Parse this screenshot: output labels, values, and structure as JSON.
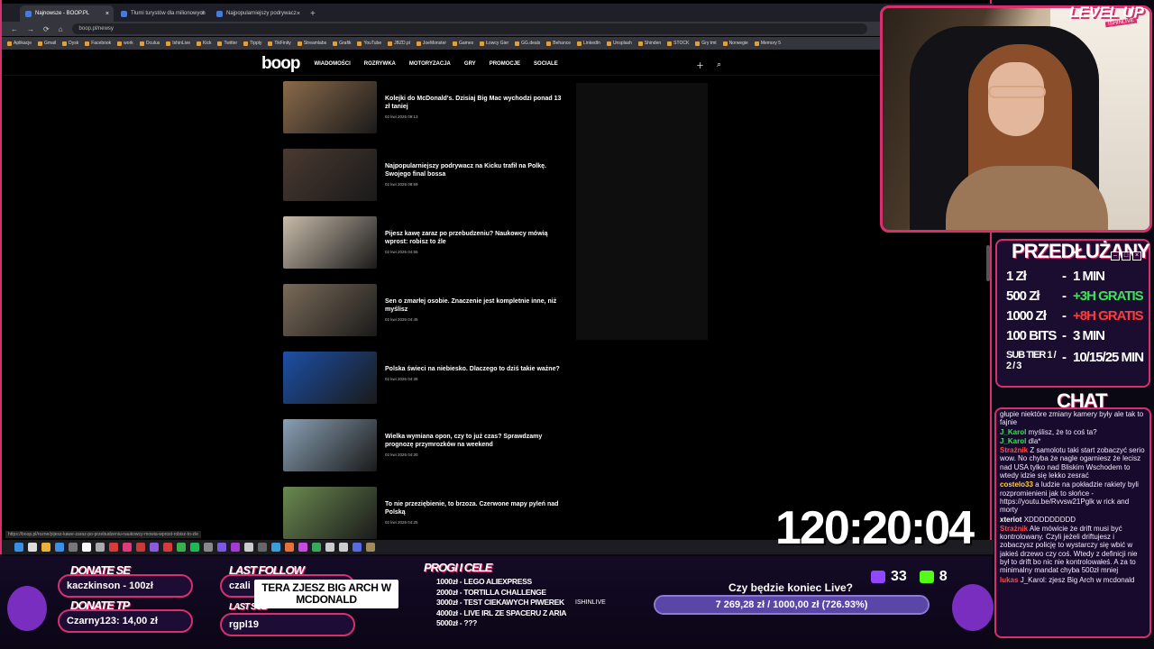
{
  "browser": {
    "tabs": [
      {
        "label": "Najnowsze - BOOP.PL",
        "active": true
      },
      {
        "label": "Tłumi turystów dla milionowych",
        "active": false
      },
      {
        "label": "Najpopularniejszy podrywacz",
        "active": false
      }
    ],
    "url": "boop.pl/newsy",
    "bookmarks": [
      "Aplikacje",
      "Gmail",
      "Dysk",
      "Facebook",
      "work",
      "Oculus",
      "IshinLive",
      "Kick",
      "Twitter",
      "Tipply",
      "TikFinity",
      "Streamlabs",
      "Grafik",
      "YouTube",
      "JBZD.pl",
      "JoeMonster",
      "Games",
      "Łowcy Gier",
      "GG.deals",
      "Behance",
      "LinkedIn",
      "Unsplash",
      "Shinden",
      "STOCK",
      "Gry tmt",
      "Norwegie",
      "Memory 5"
    ],
    "status_url": "https://boop.pl/rozne/pijesz-kawe-zaraz-po-przebudzeniu-naukowcy-mowia-wprost-robisz-to-zle"
  },
  "site": {
    "logo": "boop",
    "nav": [
      "WIADOMOŚCI",
      "ROZRYWKA",
      "MOTORYZACJA",
      "GRY",
      "PROMOCJE",
      "SOCIALE"
    ],
    "articles": [
      {
        "title": "Kolejki do McDonald's. Dzisiaj Big Mac wychodzi ponad 13 zł taniej",
        "date": "02 kwi 2026 09:13",
        "color": "#8a6a4a"
      },
      {
        "title": "Najpopularniejszy podrywacz na Kicku trafił na Polkę. Swojego final bossa",
        "date": "02 kwi 2026 08:59",
        "color": "#4a3a30"
      },
      {
        "title": "Pijesz kawę zaraz po przebudzeniu? Naukowcy mówią wprost: robisz to źle",
        "date": "02 kwi 2026 04:55",
        "color": "#c8bcaa"
      },
      {
        "title": "Sen o zmarłej osobie. Znaczenie jest kompletnie inne, niż myślisz",
        "date": "02 kwi 2026 04:45",
        "color": "#7a6a58"
      },
      {
        "title": "Polska świeci na niebiesko. Dlaczego to dziś takie ważne?",
        "date": "02 kwi 2026 04:38",
        "color": "#1c4fa6"
      },
      {
        "title": "Wielka wymiana opon, czy to już czas? Sprawdzamy prognozę przymrozków na weekend",
        "date": "02 kwi 2026 04:30",
        "color": "#8aa0b4"
      },
      {
        "title": "To nie przeziębienie, to brzoza. Czerwone mapy pyleń nad Polską",
        "date": "02 kwi 2026 04:25",
        "color": "#6a8a50"
      }
    ]
  },
  "stream": {
    "logo": "LEVEL UP",
    "logo_sub": "ISHINLIVE",
    "prices_title": "PRZEDŁUŻANY",
    "prices": [
      {
        "item": "1 Zł",
        "value": "1 MIN",
        "color": "#ffffff"
      },
      {
        "item": "500 Zł",
        "value": "+3H GRATIS",
        "color": "#3ee05a"
      },
      {
        "item": "1000 Zł",
        "value": "+8H GRATIS",
        "color": "#ff3b3b"
      },
      {
        "item": "100 BITS",
        "value": "3 MIN",
        "color": "#ffffff"
      },
      {
        "item": "SUB TIER 1 / 2 / 3",
        "value": "10/15/25 MIN",
        "color": "#ffffff"
      }
    ],
    "chat_title": "CHAT",
    "chat": [
      {
        "user": "",
        "text": "głupie niektóre zmiany kamery były ale tak to fajnie",
        "color": "#ffffff"
      },
      {
        "user": "J_Karol",
        "text": "myślisz, że to coś ta?",
        "color": "#3ee05a"
      },
      {
        "user": "J_Karol",
        "text": "dla*",
        "color": "#3ee05a"
      },
      {
        "user": "Strażnik",
        "text": "Z samolotu taki start zobaczyć serio wow. No chyba że nagle ogarniesz że lecisz nad USA tylko nad Bliskim Wschodem to wtedy idzie się lekko zesrać",
        "color": "#ff4a4a"
      },
      {
        "user": "costelo33",
        "text": "a ludzie na pokładzie rakiety byli rozpromienieni jak to słońce - https://youtu.be/Rvvsw21Pglk w rick and morty",
        "color": "#ffd23a"
      },
      {
        "user": "xteriot",
        "text": "XDDDDDDDDD",
        "color": "#ffffff"
      },
      {
        "user": "Strażnik",
        "text": "Ale mówicie że drift musi być kontrolowany. Czyli jeżeli driftujesz i zobaczysz policję to wystarczy się wbić w jakieś drzewo czy coś. Wtedy z definicji nie był to drift bo nic nie kontrolowałeś. A za to minimalny mandat chyba 500zł mniej",
        "color": "#ff4a4a"
      },
      {
        "user": "lukas",
        "text": "J_Karol: zjesz Big Arch w mcdonald",
        "color": "#ff4a4a"
      }
    ],
    "timer": "120:20:04",
    "donate_se_title": "DONATE SE",
    "donate_se_value": "kaczkinson - 100zł",
    "donate_tp_title": "DONATE TP",
    "donate_tp_value": "Czarny123: 14,00 zł",
    "last_follow_title": "LAST FOLLOW",
    "last_follow_value": "czali",
    "last_sub_title": "LAST SUB",
    "last_sub_value": "rgpl19",
    "banner": "TERA ZJESZ BIG ARCH W MCDONALD",
    "progi_title": "PROGI I CELE",
    "progi": [
      "1000zł - LEGO ALIEXPRESS",
      "2000zł - TORTILLA CHALLENGE",
      "3000zł - TEST CIEKAWYCH PIWEREK",
      "4000zł - LIVE IRL ZE SPACERU Z ARIA",
      "5000zł - ???"
    ],
    "progi_label": "ISHINLIVE",
    "goal_title": "Czy będzie koniec Live?",
    "goal_text": "7 269,28 zł / 1000,00 zł (726.93%)",
    "goal_fraction": 1.0,
    "twitch_count": "33",
    "kick_count": "8"
  }
}
